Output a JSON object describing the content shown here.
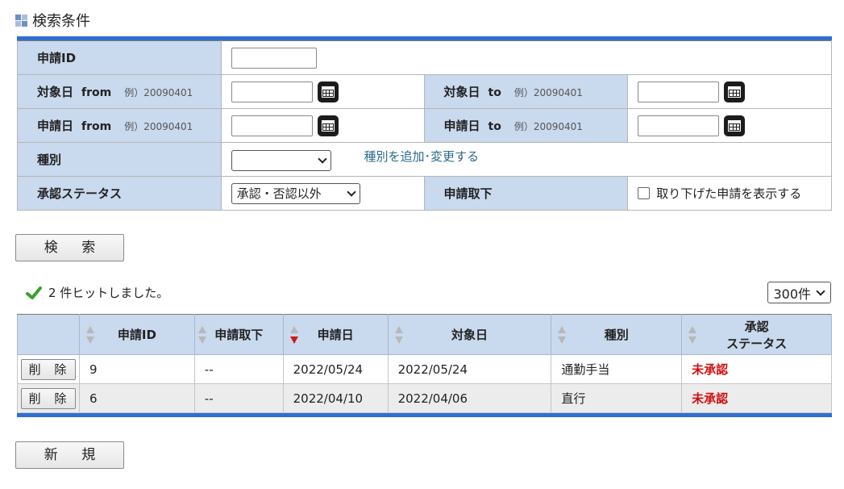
{
  "section_title": "検索条件",
  "form": {
    "app_id_label": "申請ID",
    "app_id_value": "",
    "target_from_label": "対象日",
    "target_from_eng": "from",
    "target_to_label": "対象日",
    "target_to_eng": "to",
    "apply_from_label": "申請日",
    "apply_from_eng": "from",
    "apply_to_label": "申請日",
    "apply_to_eng": "to",
    "date_example": "例）20090401",
    "type_label": "種別",
    "type_value": "",
    "type_link": "種別を追加･変更する",
    "status_label": "承認ステータス",
    "status_value": "承認・否認以外",
    "withdraw_label": "申請取下",
    "withdraw_checkbox_label": "取り下げた申請を表示する"
  },
  "search_button": "検 索",
  "hits_text": "2 件ヒットしました。",
  "per_page": "300件",
  "results": {
    "headers": {
      "id": "申請ID",
      "withdraw": "申請取下",
      "apply_date": "申請日",
      "target_date": "対象日",
      "type": "種別",
      "status_line1": "承認",
      "status_line2": "ステータス"
    },
    "rows": [
      {
        "delete": "削 除",
        "id": "9",
        "withdraw": "--",
        "apply_date": "2022/05/24",
        "target_date": "2022/05/24",
        "type": "通勤手当",
        "status": "未承認"
      },
      {
        "delete": "削 除",
        "id": "6",
        "withdraw": "--",
        "apply_date": "2022/04/10",
        "target_date": "2022/04/06",
        "type": "直行",
        "status": "未承認"
      }
    ]
  },
  "new_button": "新 規",
  "colors": {
    "accent": "#2f6fd0",
    "label_bg": "#c9d9ee",
    "status_red": "#d01010"
  }
}
